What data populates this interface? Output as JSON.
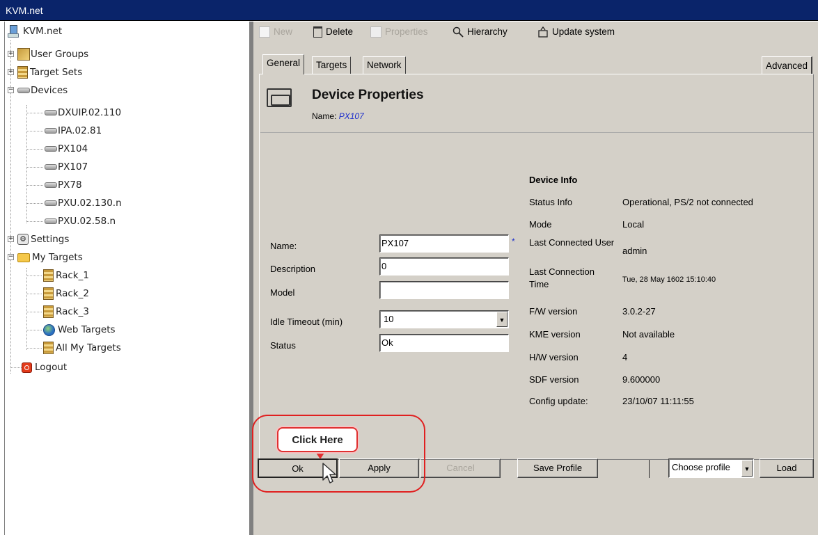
{
  "window": {
    "title": "KVM.net"
  },
  "tree": {
    "root": "KVM.net",
    "user_groups": "User Groups",
    "target_sets": "Target Sets",
    "devices": "Devices",
    "device_items": [
      "DXUIP.02.110",
      "IPA.02.81",
      "PX104",
      "PX107",
      "PX78",
      "PXU.02.130.n",
      "PXU.02.58.n"
    ],
    "settings": "Settings",
    "my_targets": "My Targets",
    "target_items": [
      "Rack_1",
      "Rack_2",
      "Rack_3"
    ],
    "web_targets": "Web Targets",
    "all_my_targets": "All My Targets",
    "logout": "Logout",
    "expand_plus": "+",
    "collapse_minus": "−"
  },
  "toolbar": {
    "new": "New",
    "delete": "Delete",
    "properties": "Properties",
    "hierarchy": "Hierarchy",
    "update_system": "Update system"
  },
  "tabs": {
    "general": "General",
    "targets": "Targets",
    "network": "Network",
    "advanced": "Advanced"
  },
  "header": {
    "title": "Device Properties",
    "name_label": "Name:",
    "name_value": "PX107"
  },
  "form": {
    "name_label": "Name:",
    "name_value": "PX107",
    "required_mark": "*",
    "description_label": "Description",
    "description_value": "0",
    "model_label": "Model",
    "model_value": "",
    "idle_label": "Idle Timeout (min)",
    "idle_value": "10",
    "status_label": "Status",
    "status_value": "Ok"
  },
  "device_info": {
    "heading": "Device Info",
    "rows": [
      {
        "label": "Status Info",
        "value": "Operational, PS/2 not connected"
      },
      {
        "label": "Mode",
        "value": "Local"
      },
      {
        "label": "Last Connected User",
        "value": "admin"
      },
      {
        "label": "Last Connection Time",
        "value": "Tue, 28 May 1602 15:10:40"
      },
      {
        "label": "F/W version",
        "value": "3.0.2-27"
      },
      {
        "label": "KME version",
        "value": "Not available"
      },
      {
        "label": "H/W version",
        "value": "4"
      },
      {
        "label": "SDF version",
        "value": "9.600000"
      },
      {
        "label": "Config update:",
        "value": "23/10/07 11:11:55"
      }
    ]
  },
  "buttons": {
    "ok": "Ok",
    "apply": "Apply",
    "cancel": "Cancel",
    "save_profile": "Save Profile",
    "profile_select": "Choose profile",
    "load": "Load"
  },
  "callout": {
    "text": "Click Here"
  },
  "colors": {
    "titlebar": "#0a246a",
    "panel": "#d4d0c8",
    "highlight": "#e02020",
    "link": "#1a2ccc"
  }
}
